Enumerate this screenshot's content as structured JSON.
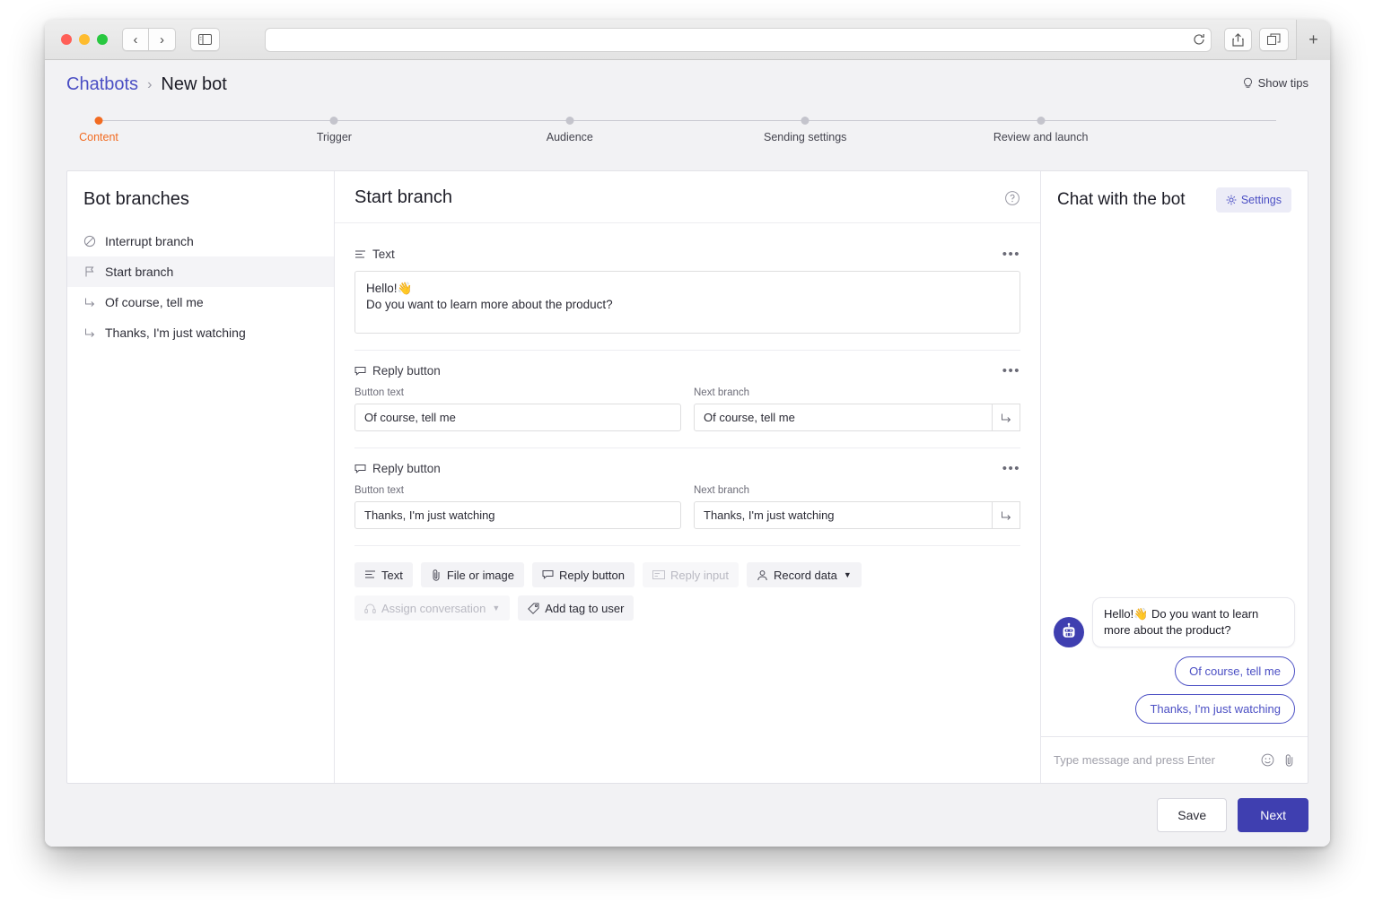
{
  "browser": {
    "back_label": "‹",
    "forward_label": "›",
    "url_value": "",
    "icons": {
      "sidebar": "sidebar-icon",
      "reload": "reload-icon",
      "share": "share-icon",
      "tabs": "tab-overview-icon",
      "new_tab": "+"
    }
  },
  "header": {
    "breadcrumb_root": "Chatbots",
    "breadcrumb_separator": "›",
    "breadcrumb_current": "New bot",
    "show_tips": "Show tips"
  },
  "stepper": {
    "active_color": "#f26b21",
    "steps": [
      {
        "label": "Content",
        "active": true
      },
      {
        "label": "Trigger",
        "active": false
      },
      {
        "label": "Audience",
        "active": false
      },
      {
        "label": "Sending settings",
        "active": false
      },
      {
        "label": "Review and launch",
        "active": false
      }
    ]
  },
  "sidebar": {
    "title": "Bot branches",
    "items": [
      {
        "label": "Interrupt branch",
        "icon": "ban-icon",
        "selected": false
      },
      {
        "label": "Start branch",
        "icon": "flag-icon",
        "selected": true
      },
      {
        "label": "Of course, tell me",
        "icon": "arrow-turn-icon",
        "selected": false
      },
      {
        "label": "Thanks, I'm just watching",
        "icon": "arrow-turn-icon",
        "selected": false
      }
    ]
  },
  "editor": {
    "title": "Start branch",
    "help_icon": "help-circle-icon",
    "text_block": {
      "type_label": "Text",
      "menu_label": "•••",
      "line1": "Hello!👋",
      "line2": "Do you want to learn more about the product?"
    },
    "reply_buttons": [
      {
        "type_label": "Reply button",
        "menu_label": "•••",
        "button_text_label": "Button text",
        "button_text_value": "Of course, tell me",
        "next_branch_label": "Next branch",
        "next_branch_value": "Of course, tell me",
        "go_icon": "arrow-turn-icon"
      },
      {
        "type_label": "Reply button",
        "menu_label": "•••",
        "button_text_label": "Button text",
        "button_text_value": "Thanks, I'm just watching",
        "next_branch_label": "Next branch",
        "next_branch_value": "Thanks, I'm just watching",
        "go_icon": "arrow-turn-icon"
      }
    ],
    "toolbar": [
      {
        "label": "Text",
        "icon": "text-lines-icon",
        "disabled": false,
        "dropdown": false
      },
      {
        "label": "File or image",
        "icon": "paperclip-icon",
        "disabled": false,
        "dropdown": false
      },
      {
        "label": "Reply button",
        "icon": "reply-bubble-icon",
        "disabled": false,
        "dropdown": false
      },
      {
        "label": "Reply input",
        "icon": "input-field-icon",
        "disabled": true,
        "dropdown": false
      },
      {
        "label": "Record data",
        "icon": "user-icon",
        "disabled": false,
        "dropdown": true
      },
      {
        "label": "Assign conversation",
        "icon": "headset-icon",
        "disabled": true,
        "dropdown": true
      },
      {
        "label": "Add tag to user",
        "icon": "tag-icon",
        "disabled": false,
        "dropdown": false
      }
    ]
  },
  "chat": {
    "title": "Chat with the bot",
    "settings_label": "Settings",
    "settings_icon": "gear-icon",
    "avatar_icon": "robot-avatar-icon",
    "avatar_color": "#3f3fb0",
    "bot_message": "Hello!👋 Do you want to learn more about the product?",
    "reply_options": [
      "Of course, tell me",
      "Thanks, I'm just watching"
    ],
    "input_placeholder": "Type message and press Enter",
    "emoji_icon": "smiley-icon",
    "attach_icon": "paperclip-icon"
  },
  "footer": {
    "save_label": "Save",
    "next_label": "Next",
    "next_color": "#3f3fb0"
  }
}
